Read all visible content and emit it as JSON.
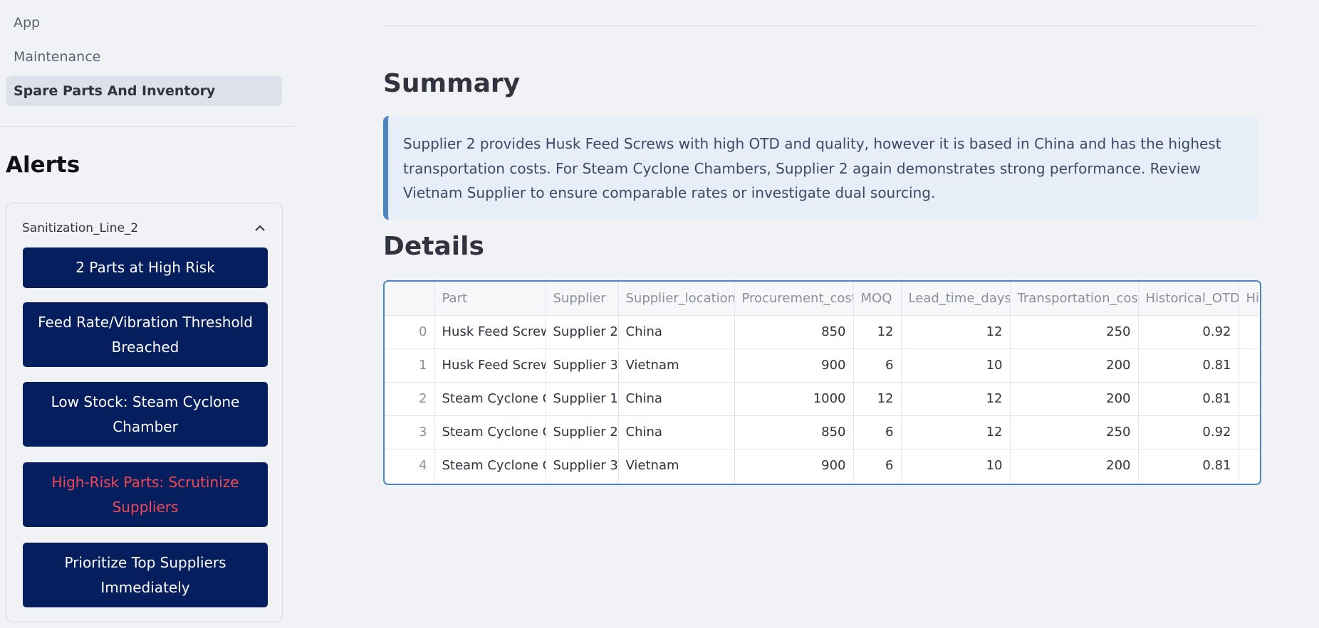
{
  "sidebar": {
    "nav": [
      {
        "label": "App"
      },
      {
        "label": "Maintenance"
      },
      {
        "label": "Spare Parts And Inventory"
      }
    ],
    "alerts_title": "Alerts",
    "expander": {
      "title": "Sanitization_Line_2",
      "buttons": [
        {
          "label": "2 Parts at High Risk"
        },
        {
          "label": "Feed Rate/Vibration Threshold Breached"
        },
        {
          "label": "Low Stock: Steam Cyclone Chamber"
        },
        {
          "label": "High-Risk Parts: Scrutinize Suppliers"
        },
        {
          "label": "Prioritize Top Suppliers Immediately"
        }
      ]
    }
  },
  "main": {
    "summary_title": "Summary",
    "summary_text": "Supplier 2 provides Husk Feed Screws with high OTD and quality, however it is based in China and has the highest transportation costs. For Steam Cyclone Chambers, Supplier 2 again demonstrates strong performance. Review Vietnam Supplier to ensure comparable rates or investigate dual sourcing.",
    "details_title": "Details",
    "table": {
      "columns": [
        "",
        "Part",
        "Supplier",
        "Supplier_location",
        "Procurement_cost",
        "MOQ",
        "Lead_time_days",
        "Transportation_cost",
        "Historical_OTD",
        "His"
      ],
      "rows": [
        [
          "0",
          "Husk Feed Screw",
          "Supplier 2",
          "China",
          "850",
          "12",
          "12",
          "250",
          "0.92",
          ""
        ],
        [
          "1",
          "Husk Feed Screw",
          "Supplier 3",
          "Vietnam",
          "900",
          "6",
          "10",
          "200",
          "0.81",
          ""
        ],
        [
          "2",
          "Steam Cyclone Chamber",
          "Supplier 1",
          "China",
          "1000",
          "12",
          "12",
          "200",
          "0.81",
          ""
        ],
        [
          "3",
          "Steam Cyclone Chamber",
          "Supplier 2",
          "China",
          "850",
          "6",
          "12",
          "250",
          "0.92",
          ""
        ],
        [
          "4",
          "Steam Cyclone Chamber",
          "Supplier 3",
          "Vietnam",
          "900",
          "6",
          "10",
          "200",
          "0.81",
          ""
        ]
      ]
    }
  },
  "colors": {
    "alert_button_bg": "#041e5e",
    "alert_button_text": "#ffffff",
    "alert_button_warning_text": "#ef4a55",
    "info_box_bg": "#e8eef7",
    "info_box_border": "#4d86bf"
  },
  "icons": {
    "expander_toggle": "chevron-up-icon"
  }
}
